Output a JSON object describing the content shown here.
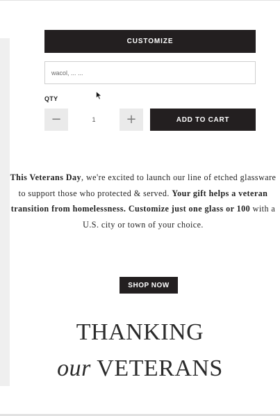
{
  "product_form": {
    "customize_label": "CUSTOMIZE",
    "text_input_value": "wacol, ... ...",
    "qty_label": "QTY",
    "qty_value": "1",
    "decrement_symbol": "−",
    "increment_symbol": "+",
    "add_to_cart_label": "ADD TO CART"
  },
  "promo": {
    "bold_1": "This Veterans Day",
    "text_1": ", we're excited to launch our line of etched glassware to support those who protected & served. ",
    "bold_2": "Your gift helps a veteran transition from homelessness. Customize just one glass or 100",
    "text_2": " with a U.S. city or town of your choice."
  },
  "shop_now_label": "SHOP NOW",
  "heading": {
    "line1": "THANKING",
    "line2_italic": "our",
    "line2_rest": " VETERANS"
  },
  "colors": {
    "button_bg": "#231f20",
    "button_text": "#ffffff",
    "stepper_bg": "#eaeaea",
    "body_text": "#1f1f1f"
  }
}
